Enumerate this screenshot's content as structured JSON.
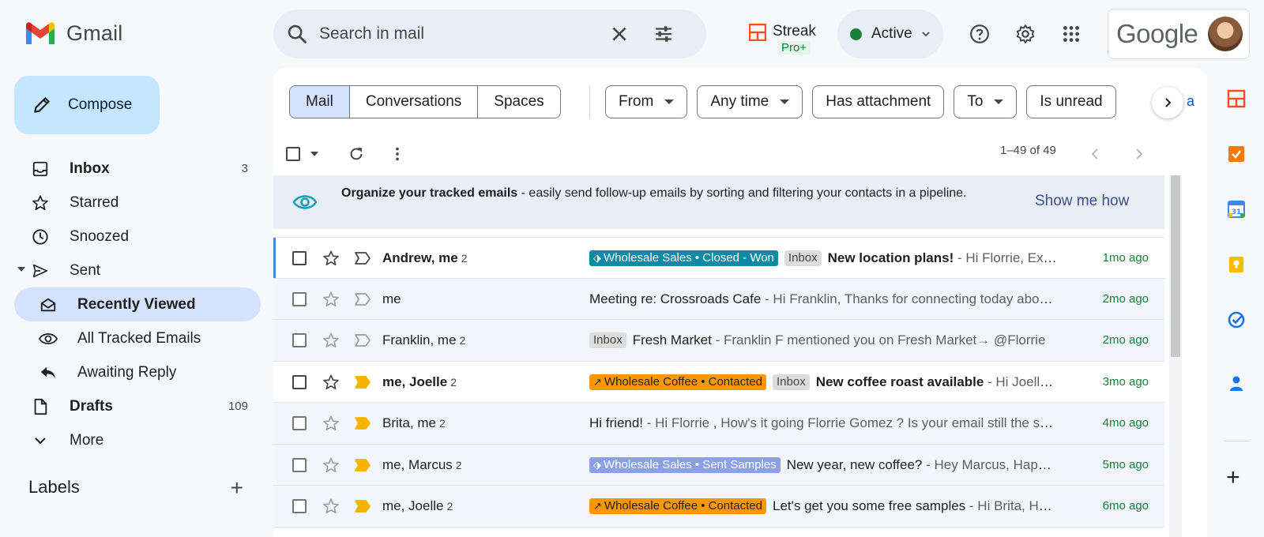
{
  "app": {
    "name": "Gmail"
  },
  "search": {
    "placeholder": "Search in mail"
  },
  "streak": {
    "title": "Streak",
    "badge": "Pro+"
  },
  "status": {
    "label": "Active",
    "color": "#188038"
  },
  "account": {
    "brand": "Google"
  },
  "compose": {
    "label": "Compose"
  },
  "nav": [
    {
      "id": "inbox",
      "label": "Inbox",
      "count": "3",
      "icon": "inbox-icon",
      "bold": true
    },
    {
      "id": "starred",
      "label": "Starred",
      "count": "",
      "icon": "star-icon"
    },
    {
      "id": "snoozed",
      "label": "Snoozed",
      "count": "",
      "icon": "clock-icon"
    },
    {
      "id": "sent",
      "label": "Sent",
      "count": "",
      "icon": "send-icon"
    },
    {
      "id": "recently-viewed",
      "label": "Recently Viewed",
      "count": "",
      "icon": "open-envelope-icon",
      "selected": true
    },
    {
      "id": "all-tracked",
      "label": "All Tracked Emails",
      "count": "",
      "icon": "eye-icon"
    },
    {
      "id": "awaiting-reply",
      "label": "Awaiting Reply",
      "count": "",
      "icon": "reply-icon"
    },
    {
      "id": "drafts",
      "label": "Drafts",
      "count": "109",
      "icon": "draft-icon",
      "bold": true
    },
    {
      "id": "more",
      "label": "More",
      "count": "",
      "icon": "chevron-down-icon"
    }
  ],
  "labels": {
    "title": "Labels"
  },
  "tabs": [
    "Mail",
    "Conversations",
    "Spaces"
  ],
  "filters": [
    "From",
    "Any time",
    "Has attachment",
    "To",
    "Is unread"
  ],
  "filters_overflow": "a",
  "pager": {
    "text": "1–49 of 49"
  },
  "banner": {
    "bold": "Organize your tracked emails",
    "text": " - easily send follow-up emails by sorting and filtering your contacts in a pipeline.",
    "action": "Show me how"
  },
  "emails": [
    {
      "sender": "Andrew, me",
      "count": "2",
      "unread": true,
      "important": false,
      "tag": {
        "text": "Wholesale Sales • Closed - Won",
        "color": "teal",
        "icon": "tag-icon"
      },
      "inbox": "Inbox",
      "subject": "New location plans!",
      "snippet": " - Hi Florrie, Excited to share our new location plans",
      "date": "1mo ago"
    },
    {
      "sender": "me",
      "count": "",
      "unread": false,
      "important": false,
      "tag": null,
      "inbox": "",
      "subject": "Meeting re: Crossroads Cafe",
      "snippet": " - Hi Franklin, Thanks for connecting today about the cafe",
      "date": "2mo ago"
    },
    {
      "sender": "Franklin, me",
      "count": "2",
      "unread": false,
      "important": false,
      "tag": null,
      "inbox": "Inbox",
      "subject": "Fresh Market",
      "snippet": " - Franklin F mentioned you on Fresh Market→ @Florrie",
      "date": "2mo ago"
    },
    {
      "sender": "me, Joelle",
      "count": "2",
      "unread": true,
      "important": true,
      "tag": {
        "text": "Wholesale Coffee • Contacted",
        "color": "orange",
        "icon": "trend-icon"
      },
      "inbox": "Inbox",
      "subject": "New coffee roast available",
      "snippet": " - Hi Joelle, We have a new roast",
      "date": "3mo ago"
    },
    {
      "sender": "Brita, me",
      "count": "2",
      "unread": false,
      "important": true,
      "tag": null,
      "inbox": "",
      "subject": "Hi friend!",
      "snippet": " - Hi Florrie , How's it going Florrie Gomez ? Is your email still the same",
      "date": "4mo ago"
    },
    {
      "sender": "me, Marcus",
      "count": "2",
      "unread": false,
      "important": true,
      "tag": {
        "text": "Wholesale Sales • Sent Samples",
        "color": "purple",
        "icon": "tag-icon"
      },
      "inbox": "",
      "subject": "New year, new coffee?",
      "snippet": " - Hey Marcus, Happy new year to you",
      "date": "5mo ago"
    },
    {
      "sender": "me, Joelle",
      "count": "2",
      "unread": false,
      "important": true,
      "tag": {
        "text": "Wholesale Coffee • Contacted",
        "color": "orange",
        "icon": "trend-icon"
      },
      "inbox": "",
      "subject": "Let's get you some free samples",
      "snippet": " - Hi Brita, Hope you're well",
      "date": "6mo ago"
    }
  ],
  "colors": {
    "accent": "#0b57d0",
    "selected": "#d3e3fd",
    "compose": "#c2e7ff",
    "date": "#188038"
  }
}
